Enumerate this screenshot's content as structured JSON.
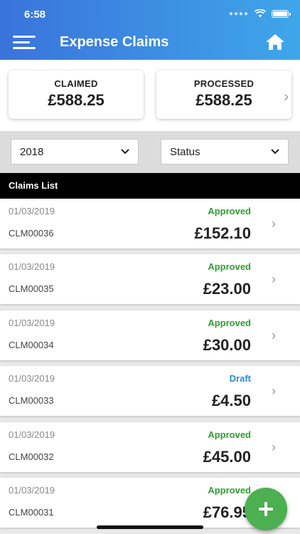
{
  "status_bar": {
    "time": "6:58"
  },
  "header": {
    "title": "Expense Claims"
  },
  "summary": {
    "claimed": {
      "label": "CLAIMED",
      "value": "£588.25"
    },
    "processed": {
      "label": "PROCESSED",
      "value": "£588.25"
    }
  },
  "filters": {
    "year": "2018",
    "status": "Status"
  },
  "list": {
    "header": "Claims List",
    "items": [
      {
        "date": "01/03/2019",
        "id": "CLM00036",
        "status": "Approved",
        "amount": "£152.10"
      },
      {
        "date": "01/03/2019",
        "id": "CLM00035",
        "status": "Approved",
        "amount": "£23.00"
      },
      {
        "date": "01/03/2019",
        "id": "CLM00034",
        "status": "Approved",
        "amount": "£30.00"
      },
      {
        "date": "01/03/2019",
        "id": "CLM00033",
        "status": "Draft",
        "amount": "£4.50"
      },
      {
        "date": "01/03/2019",
        "id": "CLM00032",
        "status": "Approved",
        "amount": "£45.00"
      },
      {
        "date": "01/03/2019",
        "id": "CLM00031",
        "status": "Approved",
        "amount": "£76.95"
      }
    ]
  },
  "colors": {
    "approved": "#2e9e2e",
    "draft": "#2a8ad8",
    "accent": "#3a73db",
    "fab": "#4caf50"
  },
  "icons": {
    "menu": "hamburger-icon",
    "home": "home-icon",
    "add": "plus-icon",
    "chevron": "chevron-right-icon",
    "dropdown": "chevron-down-icon"
  }
}
